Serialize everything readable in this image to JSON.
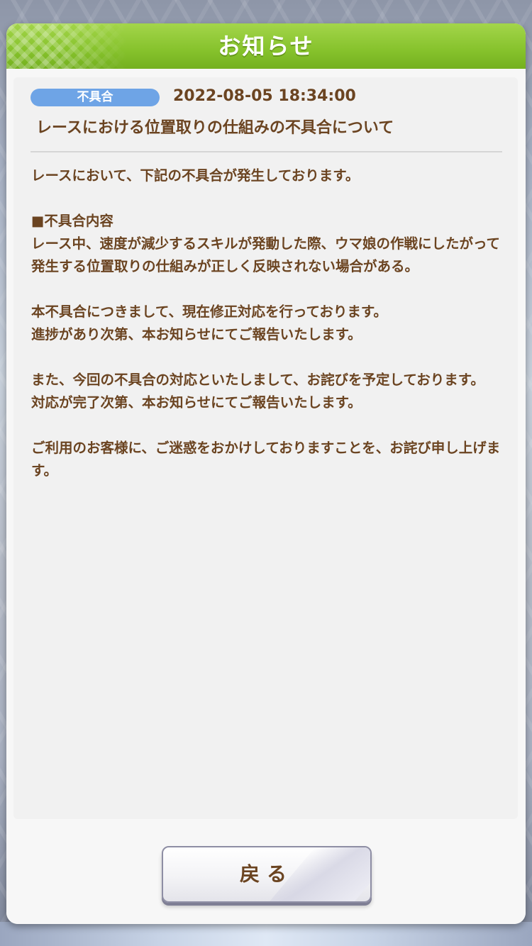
{
  "dialog": {
    "title": "お知らせ"
  },
  "notice": {
    "category": "不具合",
    "category_color": "#6ea4e6",
    "date": "2022-08-05 18:34:00",
    "title": "レースにおける位置取りの仕組みの不具合について",
    "body": "レースにおいて、下記の不具合が発生しております。\n\n■不具合内容\nレース中、速度が減少するスキルが発動した際、ウマ娘の作戦にしたがって発生する位置取りの仕組みが正しく反映されない場合がある。\n\n本不具合につきまして、現在修正対応を行っております。\n進捗があり次第、本お知らせにてご報告いたします。\n\nまた、今回の不具合の対応といたしまして、お詫びを予定しております。\n対応が完了次第、本お知らせにてご報告いたします。\n\nご利用のお客様に、ご迷惑をおかけしておりますことを、お詫び申し上げます。"
  },
  "footer": {
    "back_label": "戻る"
  },
  "colors": {
    "title_bar": "#86c22c",
    "text": "#6b4421"
  }
}
